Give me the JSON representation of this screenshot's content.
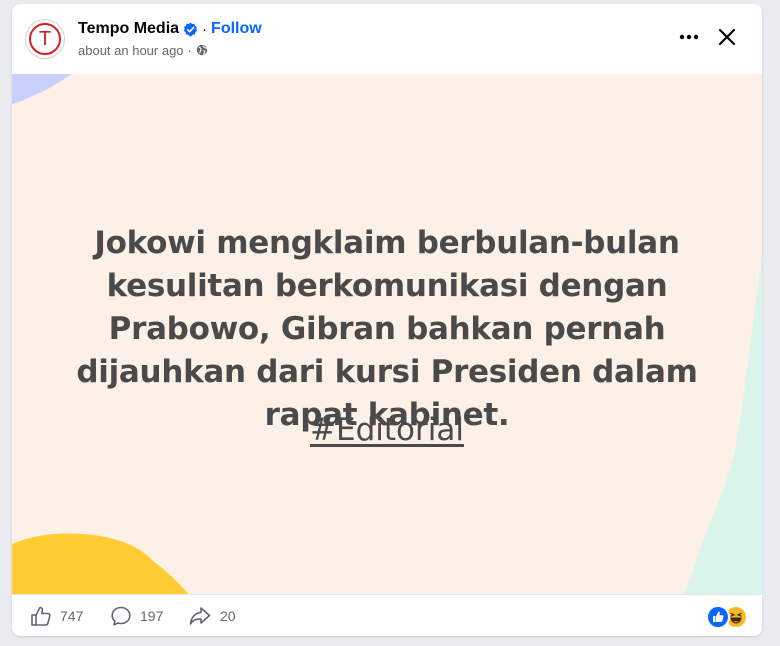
{
  "post": {
    "page_name": "Tempo Media",
    "avatar_letter": "T",
    "separator": "·",
    "follow_label": "Follow",
    "timestamp": "about an hour ago",
    "meta_separator": "·",
    "privacy_icon": "globe-icon",
    "verified_icon": "verified-badge-icon"
  },
  "image": {
    "headline": "Jokowi mengklaim berbulan-bulan kesulitan berkomunikasi dengan Prabowo, Gibran bahkan pernah dijauhkan dari kursi Presiden dalam rapat kabinet.",
    "hashtag": "#Editorial",
    "background_color": "#fdf1e7"
  },
  "actions": {
    "likes": "747",
    "comments": "197",
    "shares": "20",
    "like_icon": "thumbs-up-icon",
    "comment_icon": "comment-icon",
    "share_icon": "share-icon"
  },
  "reactions": [
    "like",
    "haha"
  ],
  "colors": {
    "brand_blue": "#0866ff",
    "avatar_red": "#d61f26",
    "text_secondary": "#65676b"
  }
}
